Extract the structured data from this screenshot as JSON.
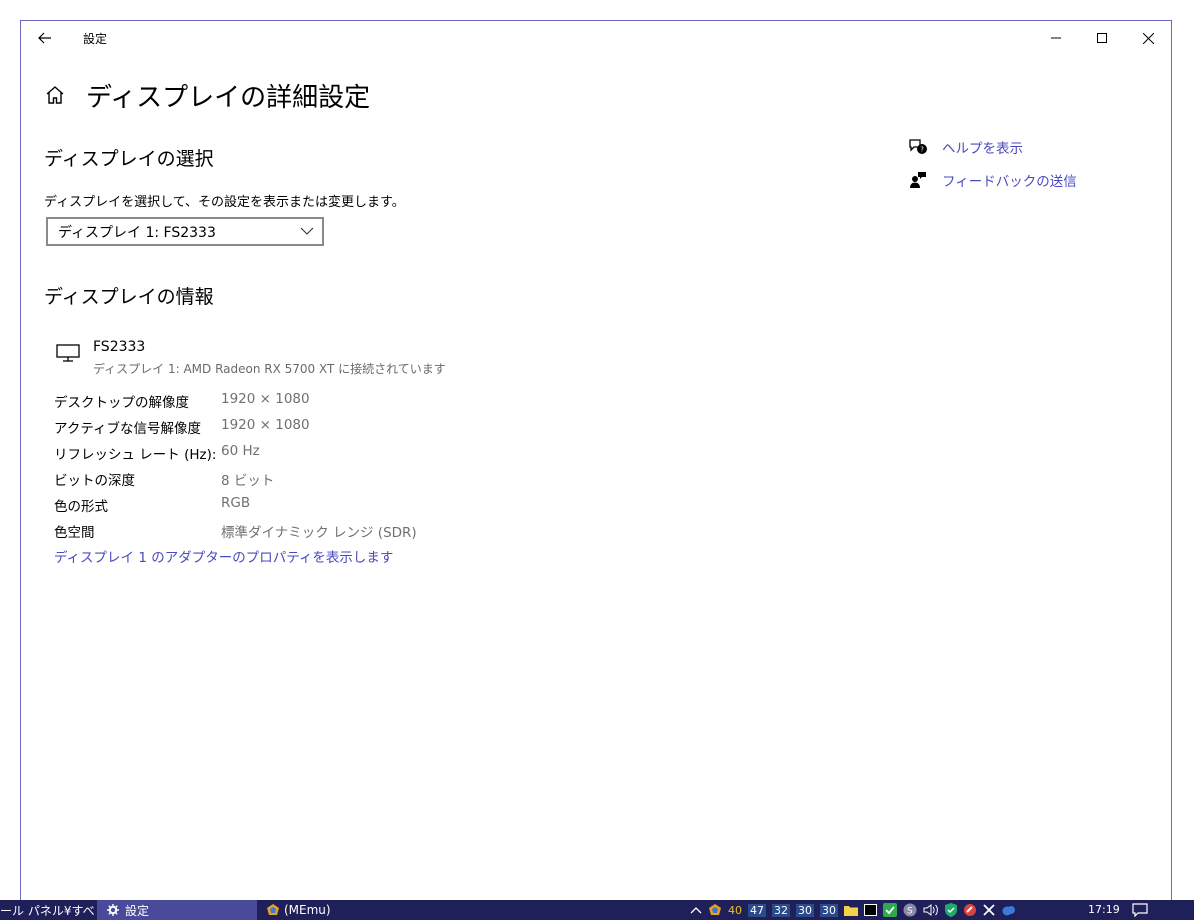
{
  "window": {
    "title": "設定"
  },
  "page": {
    "title": "ディスプレイの詳細設定"
  },
  "select_section": {
    "heading": "ディスプレイの選択",
    "description": "ディスプレイを選択して、その設定を表示または変更します。",
    "dropdown_value": "ディスプレイ 1: FS2333"
  },
  "info_section": {
    "heading": "ディスプレイの情報",
    "monitor_name": "FS2333",
    "monitor_sub": "ディスプレイ 1: AMD Radeon RX 5700 XT に接続されています",
    "rows": [
      {
        "label": "デスクトップの解像度",
        "value": "1920 × 1080"
      },
      {
        "label": "アクティブな信号解像度",
        "value": "1920 × 1080"
      },
      {
        "label": "リフレッシュ レート (Hz):",
        "value": "60 Hz"
      },
      {
        "label": "ビットの深度",
        "value": "8 ビット"
      },
      {
        "label": "色の形式",
        "value": "RGB"
      },
      {
        "label": "色空間",
        "value": "標準ダイナミック レンジ (SDR)"
      }
    ],
    "adapter_link": "ディスプレイ 1 のアダプターのプロパティを表示します"
  },
  "side_links": {
    "help": "ヘルプを表示",
    "feedback": "フィードバックの送信"
  },
  "taskbar": {
    "item1": "ール パネル¥すべ...",
    "item2": "設定",
    "item3": "(MEmu)",
    "tray_temp": "40",
    "tray_nums": [
      "47",
      "32",
      "30",
      "30"
    ],
    "clock": "17:19"
  },
  "colors": {
    "accent_link": "#4a4ac0",
    "taskbar": "#1f1f5a",
    "border": "#6b6bbf"
  }
}
